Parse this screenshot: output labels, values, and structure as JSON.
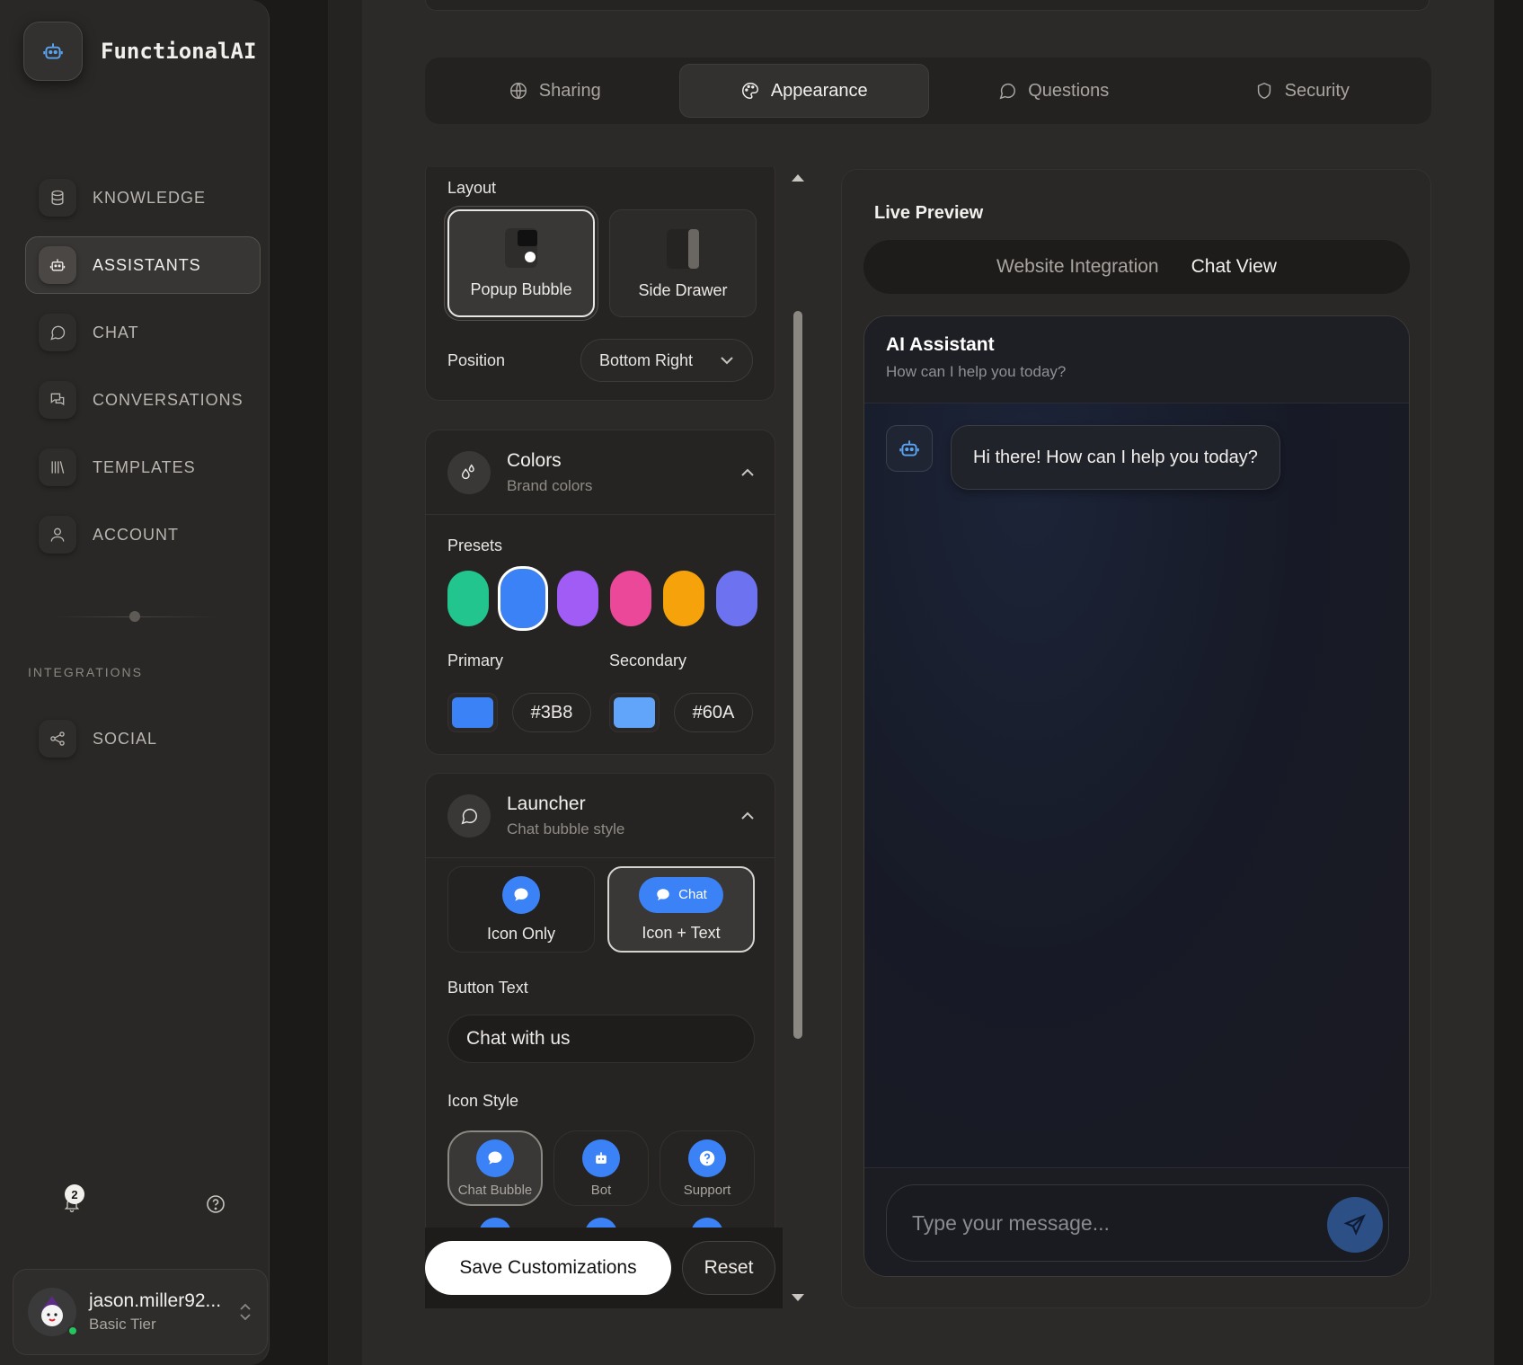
{
  "app": {
    "name": "FunctionalAI"
  },
  "sidebar": {
    "items": [
      {
        "label": "KNOWLEDGE",
        "icon": "database-icon"
      },
      {
        "label": "ASSISTANTS",
        "icon": "robot-icon",
        "active": true
      },
      {
        "label": "CHAT",
        "icon": "chat-icon"
      },
      {
        "label": "CONVERSATIONS",
        "icon": "conversations-icon"
      },
      {
        "label": "TEMPLATES",
        "icon": "library-icon"
      },
      {
        "label": "ACCOUNT",
        "icon": "user-icon"
      }
    ],
    "integrations_title": "INTEGRATIONS",
    "integrations": [
      {
        "label": "SOCIAL",
        "icon": "share-icon"
      }
    ],
    "notification_count": "2",
    "user": {
      "name": "jason.miller92...",
      "tier": "Basic Tier"
    }
  },
  "tabs": [
    {
      "label": "Sharing",
      "icon": "globe-icon"
    },
    {
      "label": "Appearance",
      "icon": "palette-icon",
      "active": true
    },
    {
      "label": "Questions",
      "icon": "message-icon"
    },
    {
      "label": "Security",
      "icon": "shield-icon"
    }
  ],
  "layout": {
    "title": "Layout",
    "options": [
      {
        "label": "Popup Bubble",
        "selected": true
      },
      {
        "label": "Side Drawer"
      }
    ],
    "position_label": "Position",
    "position_value": "Bottom Right"
  },
  "colors": {
    "title": "Colors",
    "subtitle": "Brand colors",
    "presets_label": "Presets",
    "presets": [
      "#22c58e",
      "#3b82f6",
      "#a05cf5",
      "#ec4899",
      "#f5a20b",
      "#6d73f0"
    ],
    "selected_preset": 1,
    "primary_label": "Primary",
    "primary_color": "#3b82f6",
    "primary_hex": "#3B8",
    "secondary_label": "Secondary",
    "secondary_color": "#60a5fa",
    "secondary_hex": "#60A"
  },
  "launcher": {
    "title": "Launcher",
    "subtitle": "Chat bubble style",
    "options": [
      {
        "label": "Icon Only"
      },
      {
        "label": "Icon + Text",
        "pill_text": "Chat",
        "selected": true
      }
    ],
    "button_text_label": "Button Text",
    "button_text_value": "Chat with us",
    "icon_style_label": "Icon Style",
    "icon_styles": [
      {
        "label": "Chat Bubble",
        "icon": "chat-bubble-icon",
        "selected": true
      },
      {
        "label": "Bot",
        "icon": "bot-icon"
      },
      {
        "label": "Support",
        "icon": "help-icon"
      }
    ]
  },
  "actions": {
    "save": "Save Customizations",
    "reset": "Reset"
  },
  "preview": {
    "title": "Live Preview",
    "modes": [
      {
        "label": "Website Integration"
      },
      {
        "label": "Chat View",
        "active": true
      }
    ],
    "widget_title": "AI Assistant",
    "widget_subtitle": "How can I help you today?",
    "message": "Hi there! How can I help you today?",
    "input_placeholder": "Type your message..."
  }
}
